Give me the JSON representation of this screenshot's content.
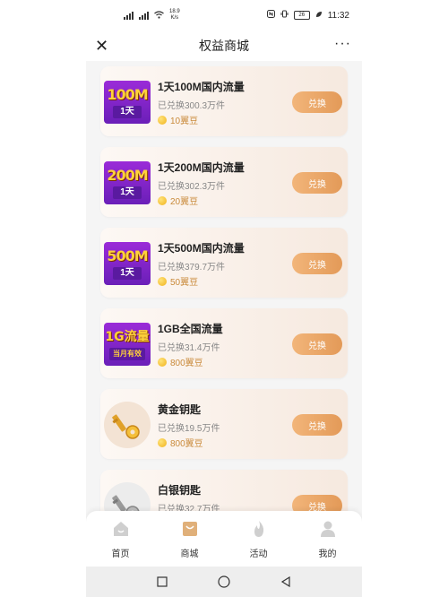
{
  "status_bar": {
    "network_speed": "18.9",
    "network_unit": "K/s",
    "battery": "26",
    "time": "11:32"
  },
  "header": {
    "title": "权益商城",
    "more": "···"
  },
  "items": [
    {
      "title": "1天100M国内流量",
      "sold": "已兑换300.3万件",
      "price": "10翼豆",
      "badge_top": "100M",
      "badge_bottom": "1天",
      "button": "兑换"
    },
    {
      "title": "1天200M国内流量",
      "sold": "已兑换302.3万件",
      "price": "20翼豆",
      "badge_top": "200M",
      "badge_bottom": "1天",
      "button": "兑换"
    },
    {
      "title": "1天500M国内流量",
      "sold": "已兑换379.7万件",
      "price": "50翼豆",
      "badge_top": "500M",
      "badge_bottom": "1天",
      "button": "兑换"
    },
    {
      "title": "1GB全国流量",
      "sold": "已兑换31.4万件",
      "price": "800翼豆",
      "badge_top": "1G流量",
      "badge_bottom": "当月有效",
      "button": "兑换"
    },
    {
      "title": "黄金钥匙",
      "sold": "已兑换19.5万件",
      "price": "800翼豆",
      "button": "兑换"
    },
    {
      "title": "白银钥匙",
      "sold": "已兑换32.7万件",
      "price": "",
      "button": "兑换"
    }
  ],
  "tabs": [
    {
      "label": "首页"
    },
    {
      "label": "商城"
    },
    {
      "label": "活动"
    },
    {
      "label": "我的"
    }
  ],
  "colors": {
    "accent": "#e39a58",
    "badge_purple": "#8a25cc",
    "badge_yellow": "#ffd23a"
  }
}
